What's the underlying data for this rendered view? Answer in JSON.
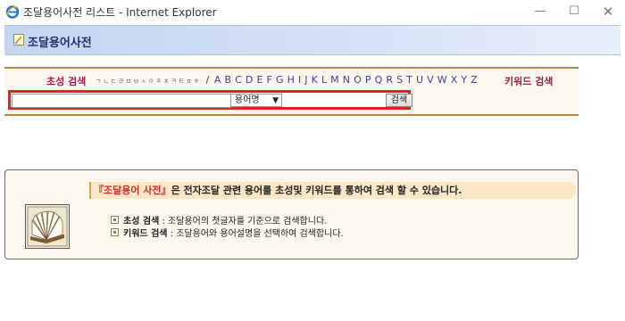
{
  "window": {
    "title": "조달용어사전 리스트 - Internet Explorer",
    "minimize": "—",
    "maximize": "☐",
    "close": "✕"
  },
  "banner": {
    "title": "조달용어사전",
    "icon": "memo-icon"
  },
  "search": {
    "initial_label": "초성 검색",
    "korean_initials": "ㄱㄴㄷㄹㅁㅂㅅㅇㅈㅊㅋㅌㅍㅎ",
    "separator": "/",
    "alphabet": "A B C D E F G H I J K L M N O P Q R S T U V W X Y Z",
    "keyword_label": "키워드 검색",
    "query_value": "",
    "field_select": "용어명",
    "button_label": "검색"
  },
  "info": {
    "head_highlight": "『조달용어 사전』",
    "head_text": "은 전자조달 관련 용어를 초성및 키워드를 통하여 검색 할 수 있습니다.",
    "rows": [
      {
        "term": "초성 검색",
        "desc": " : 조달용어의 첫글자를 기준으로 검색합니다."
      },
      {
        "term": "키워드 검색",
        "desc": " : 조달용어와 용어설명을 선택하여 검색합니다."
      }
    ],
    "icon": "open-book-icon"
  },
  "colors": {
    "accent": "#a6194f",
    "highlight_border": "#e52220",
    "panel_bg": "#fcf7ec"
  }
}
